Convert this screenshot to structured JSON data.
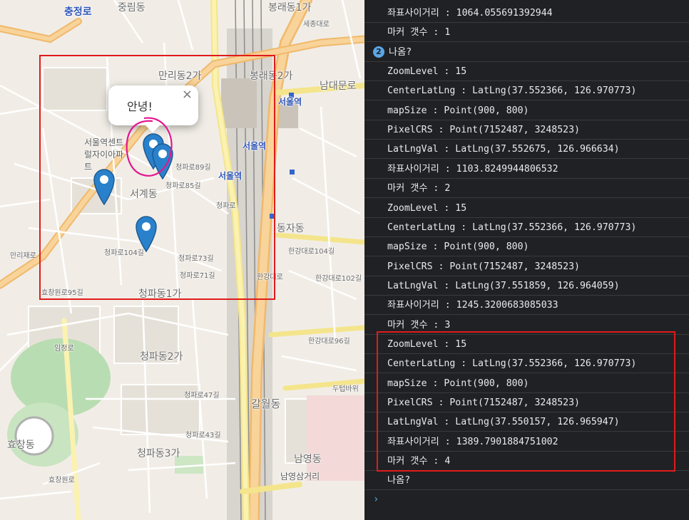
{
  "map": {
    "popup": {
      "text": "안녕!",
      "close": "×"
    },
    "labels": {
      "chungjeongro": "충정로",
      "jungrim": "중림동",
      "bongrae1": "봉래동1가",
      "mallidong2": "만리동2가",
      "bongrae2": "봉래동2가",
      "namdaemunro": "남대문로",
      "seoul_station1": "서울역",
      "seoul_station2": "서울역",
      "seoul_station3": "서울역",
      "seoul_station_center": "서울역센트럴자이아파트",
      "seogye": "서계동",
      "dongja": "동자동",
      "chungpa1": "청파동1가",
      "chungpa2": "청파동2가",
      "chungpa3": "청파동3가",
      "galwol": "갈월동",
      "namyeong": "남영동",
      "namyeong_junction": "남영삼거리",
      "hyochang": "효창동",
      "cheongparo": "청파로",
      "hangangdaero": "한강대로",
      "manlijaero": "만리재로",
      "sejongdaero": "세종대로",
      "hyochangwonro": "효창원로",
      "imjeongro": "임정로",
      "dutubaw": "두텁바위",
      "road_104": "청파로104길",
      "road_73": "청파로73길",
      "road_71": "청파로71길",
      "road_47": "청파로47길",
      "road_43": "청파로43길",
      "road_89": "청파로89길",
      "road_85": "청파로85길",
      "road_95": "효창원로95길",
      "hangang_104": "한강대로104길",
      "hangang_102": "한강대로102길",
      "hangang_96": "한강대로96길"
    }
  },
  "console": {
    "rows": [
      {
        "label": "좌표사이거리",
        "value": "1064.055691392944"
      },
      {
        "label": "마커 갯수",
        "value": "1"
      },
      {
        "group": true,
        "badge": "2",
        "text": "나옴?"
      },
      {
        "label": "ZoomLevel",
        "value": "15"
      },
      {
        "label": "CenterLatLng",
        "value": "LatLng(37.552366, 126.970773)"
      },
      {
        "label": "mapSize",
        "value": "Point(900, 800)"
      },
      {
        "label": "PixelCRS",
        "value": "Point(7152487, 3248523)"
      },
      {
        "label": "LatLngVal",
        "value": "LatLng(37.552675, 126.966634)"
      },
      {
        "label": "좌표사이거리",
        "value": "1103.8249944806532"
      },
      {
        "label": "마커 갯수",
        "value": "2"
      },
      {
        "label": "ZoomLevel",
        "value": "15"
      },
      {
        "label": "CenterLatLng",
        "value": "LatLng(37.552366, 126.970773)"
      },
      {
        "label": "mapSize",
        "value": "Point(900, 800)"
      },
      {
        "label": "PixelCRS",
        "value": "Point(7152487, 3248523)"
      },
      {
        "label": "LatLngVal",
        "value": "LatLng(37.551859, 126.964059)"
      },
      {
        "label": "좌표사이거리",
        "value": "1245.3200683085033"
      },
      {
        "label": "마커 갯수",
        "value": "3"
      },
      {
        "label": "ZoomLevel",
        "value": "15"
      },
      {
        "label": "CenterLatLng",
        "value": "LatLng(37.552366, 126.970773)"
      },
      {
        "label": "mapSize",
        "value": "Point(900, 800)"
      },
      {
        "label": "PixelCRS",
        "value": "Point(7152487, 3248523)"
      },
      {
        "label": "LatLngVal",
        "value": "LatLng(37.550157, 126.965947)"
      },
      {
        "label": "좌표사이거리",
        "value": "1389.7901884751002"
      },
      {
        "label": "마커 갯수",
        "value": "4"
      },
      {
        "plain": true,
        "text": "나옴?"
      }
    ],
    "prompt": "›",
    "separator": " : "
  },
  "colors": {
    "highlight": "#e01b1b",
    "marker": "#2a81cb",
    "annotation": "#e3168f",
    "console_bg": "#202124",
    "badge": "#5aa7e8"
  }
}
